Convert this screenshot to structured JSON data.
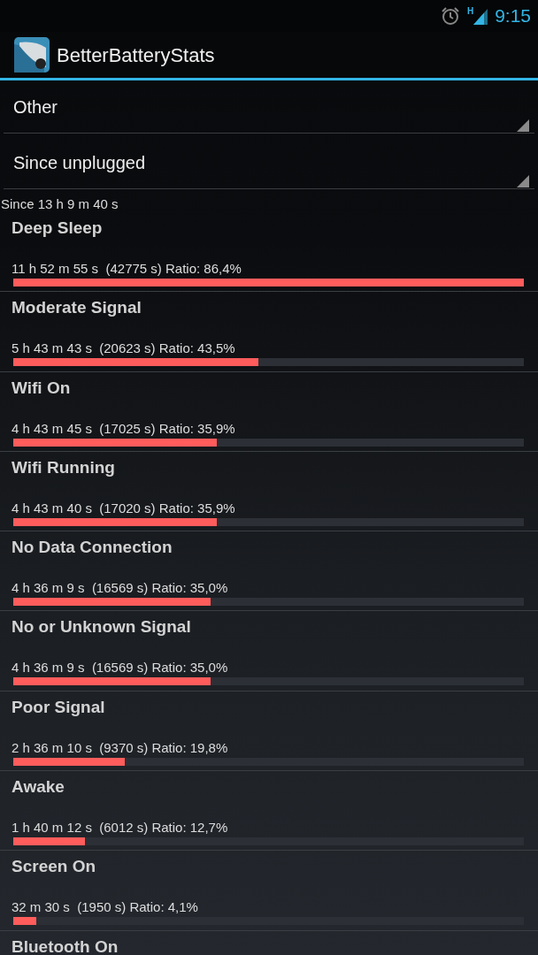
{
  "status_bar": {
    "network": "H",
    "time": "9:15"
  },
  "action_bar": {
    "title": "BetterBatteryStats"
  },
  "spinners": [
    {
      "value": "Other"
    },
    {
      "value": "Since unplugged"
    }
  ],
  "since": "Since 13 h 9 m 40 s",
  "rows": [
    {
      "name": "Deep Sleep",
      "detail": "11 h 52 m 55 s  (42775 s) Ratio: 86,4%",
      "level": 1.0
    },
    {
      "name": "Moderate Signal",
      "detail": "5 h 43 m 43 s  (20623 s) Ratio: 43,5%",
      "level": 0.48
    },
    {
      "name": "Wifi On",
      "detail": "4 h 43 m 45 s  (17025 s) Ratio: 35,9%",
      "level": 0.398
    },
    {
      "name": "Wifi Running",
      "detail": "4 h 43 m 40 s  (17020 s) Ratio: 35,9%",
      "level": 0.398
    },
    {
      "name": "No Data Connection",
      "detail": "4 h 36 m 9 s  (16569 s) Ratio: 35,0%",
      "level": 0.386
    },
    {
      "name": "No or Unknown Signal",
      "detail": "4 h 36 m 9 s  (16569 s) Ratio: 35,0%",
      "level": 0.386
    },
    {
      "name": "Poor Signal",
      "detail": "2 h 36 m 10 s  (9370 s) Ratio: 19,8%",
      "level": 0.218
    },
    {
      "name": "Awake",
      "detail": "1 h 40 m 12 s  (6012 s) Ratio: 12,7%",
      "level": 0.14
    },
    {
      "name": "Screen On",
      "detail": "32 m 30 s  (1950 s) Ratio: 4,1%",
      "level": 0.045
    },
    {
      "name": "Bluetooth On"
    }
  ]
}
